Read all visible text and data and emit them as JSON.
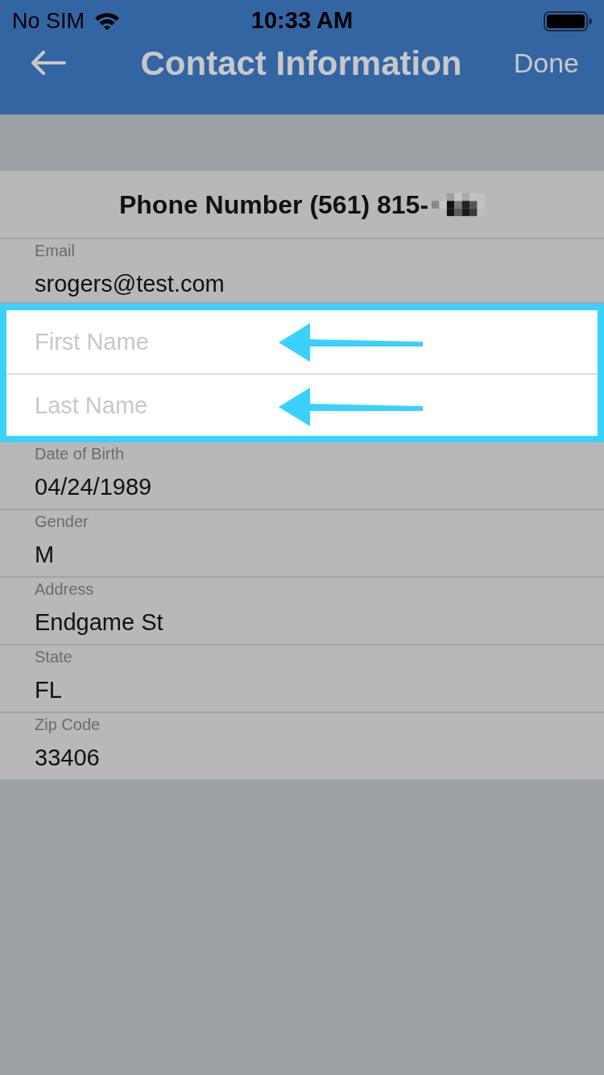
{
  "status_bar": {
    "carrier": "No SIM",
    "time": "10:33 AM"
  },
  "nav_bar": {
    "title": "Contact Information",
    "action": "Done"
  },
  "phone_header": {
    "text": "Phone Number (561) 815-",
    "redacted": true
  },
  "rows": [
    {
      "kind": "field",
      "label": "Email",
      "value": "srogers@test.com"
    },
    {
      "kind": "highlight",
      "inputs": [
        {
          "placeholder": "First Name"
        },
        {
          "placeholder": "Last Name"
        }
      ]
    },
    {
      "kind": "field",
      "label": "Date of Birth",
      "value": "04/24/1989"
    },
    {
      "kind": "field",
      "label": "Gender",
      "value": "M"
    },
    {
      "kind": "field",
      "label": "Address",
      "value": "Endgame St"
    },
    {
      "kind": "field",
      "label": "State",
      "value": "FL"
    },
    {
      "kind": "field",
      "label": "Zip Code",
      "value": "33406"
    }
  ]
}
